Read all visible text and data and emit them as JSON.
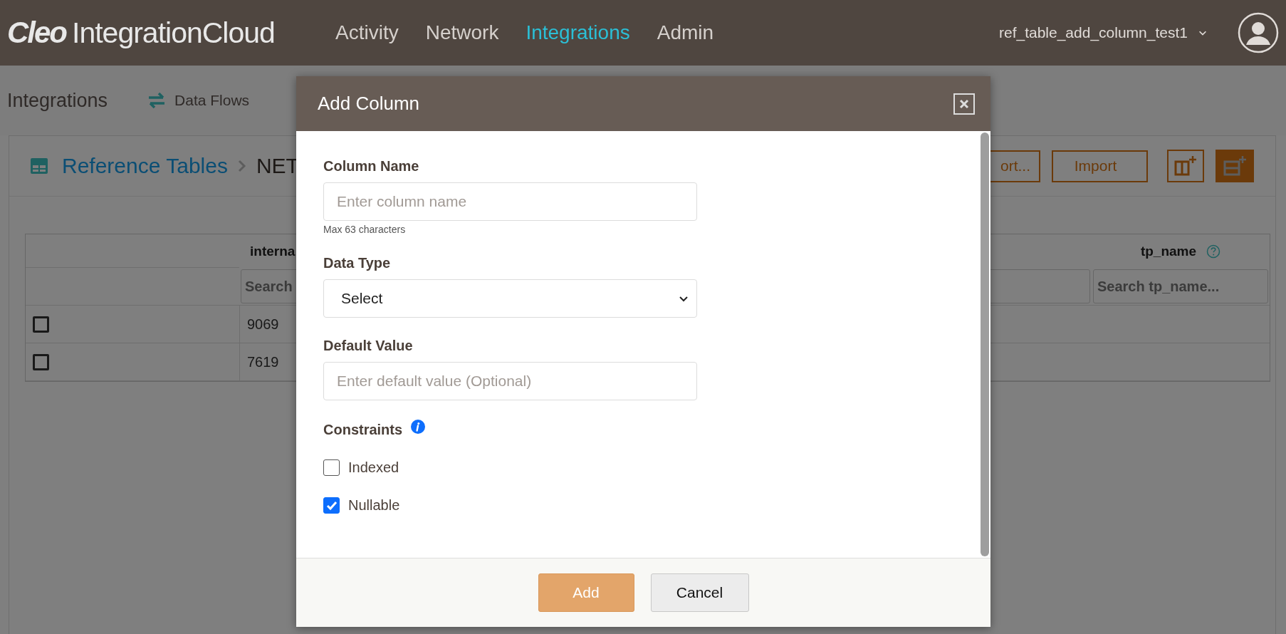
{
  "top_bar": {
    "logo": {
      "brand": "Cleo",
      "product": "IntegrationCloud"
    },
    "nav": [
      {
        "label": "Activity",
        "selected": false
      },
      {
        "label": "Network",
        "selected": false
      },
      {
        "label": "Integrations",
        "selected": true
      },
      {
        "label": "Admin",
        "selected": false
      }
    ],
    "account": {
      "name": "ref_table_add_column_test1"
    }
  },
  "sub_nav": {
    "title": "Integrations",
    "links": [
      {
        "label": "Data Flows"
      }
    ]
  },
  "card": {
    "breadcrumb": [
      {
        "label": "Reference Tables",
        "kind": "link"
      },
      {
        "label": "NET",
        "kind": "current"
      }
    ],
    "buttons": [
      {
        "kind": "text",
        "label": "ort..."
      },
      {
        "kind": "text",
        "label": "Import"
      },
      {
        "kind": "add-column",
        "primary": false
      },
      {
        "kind": "add-row",
        "primary": true
      }
    ]
  },
  "table": {
    "columns": [
      {
        "label": "interna",
        "search_placeholder": "Search"
      },
      {},
      {
        "label": "tp_name",
        "search_placeholder": "Search tp_name...",
        "help": true
      }
    ],
    "rows": [
      {
        "checked": false,
        "cells": [
          "9069"
        ]
      },
      {
        "checked": false,
        "cells": [
          "7619"
        ]
      }
    ]
  },
  "modal": {
    "title": "Add Column",
    "fields": [
      {
        "kind": "text",
        "label": "Column Name",
        "placeholder": "Enter column name",
        "hint": "Max 63 characters"
      },
      {
        "kind": "select",
        "label": "Data Type",
        "value": "Select"
      },
      {
        "kind": "text",
        "label": "Default Value",
        "placeholder": "Enter default value (Optional)"
      }
    ],
    "constraints": {
      "label": "Constraints",
      "options": [
        {
          "label": "Indexed",
          "checked": false
        },
        {
          "label": "Nullable",
          "checked": true
        }
      ]
    },
    "buttons": [
      {
        "kind": "primary",
        "label": "Add"
      },
      {
        "kind": "secondary",
        "label": "Cancel"
      }
    ]
  }
}
